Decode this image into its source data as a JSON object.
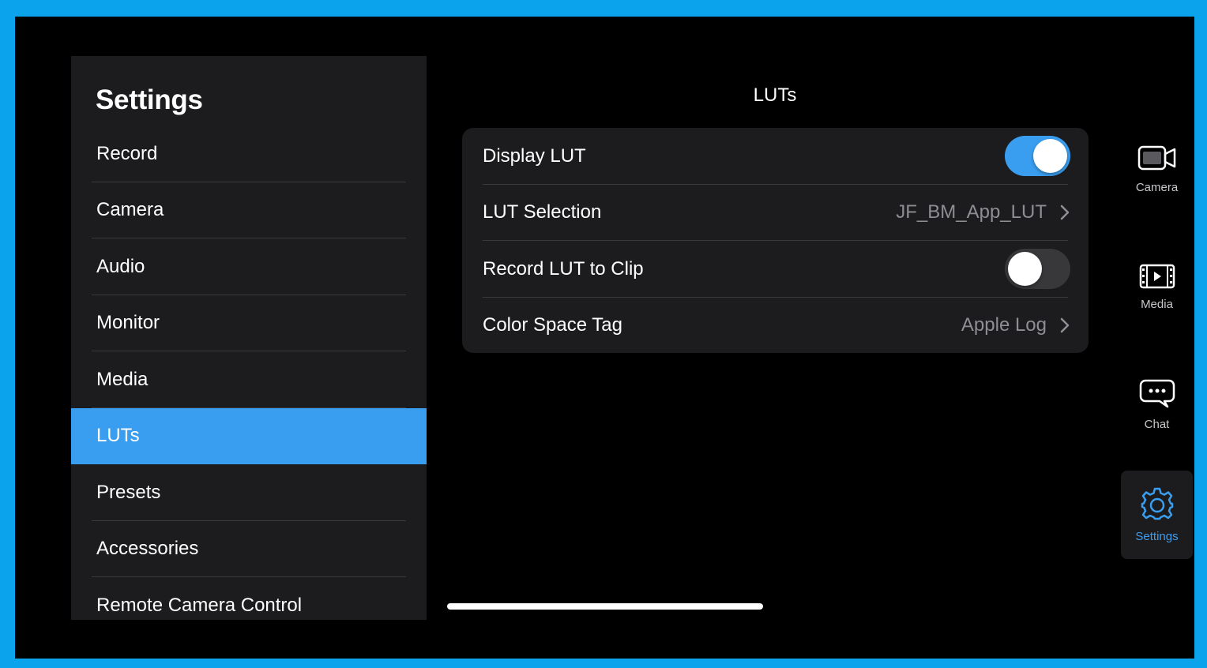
{
  "sidebar": {
    "title": "Settings",
    "items": [
      {
        "label": "Record"
      },
      {
        "label": "Camera"
      },
      {
        "label": "Audio"
      },
      {
        "label": "Monitor"
      },
      {
        "label": "Media"
      },
      {
        "label": "LUTs"
      },
      {
        "label": "Presets"
      },
      {
        "label": "Accessories"
      },
      {
        "label": "Remote Camera Control"
      }
    ],
    "active_index": 5
  },
  "main": {
    "title": "LUTs",
    "rows": [
      {
        "label": "Display LUT",
        "toggle": true
      },
      {
        "label": "LUT Selection",
        "value": "JF_BM_App_LUT"
      },
      {
        "label": "Record LUT to Clip",
        "toggle": false
      },
      {
        "label": "Color Space Tag",
        "value": "Apple Log"
      }
    ]
  },
  "rail": {
    "camera": {
      "label": "Camera",
      "icon": "camera-icon"
    },
    "media": {
      "label": "Media",
      "icon": "film-icon"
    },
    "chat": {
      "label": "Chat",
      "icon": "chat-icon"
    },
    "settings": {
      "label": "Settings",
      "icon": "gear-icon"
    }
  },
  "colors": {
    "accent": "#3a9ef0",
    "panel": "#1c1c1e",
    "frame": "#0aa3ec"
  }
}
